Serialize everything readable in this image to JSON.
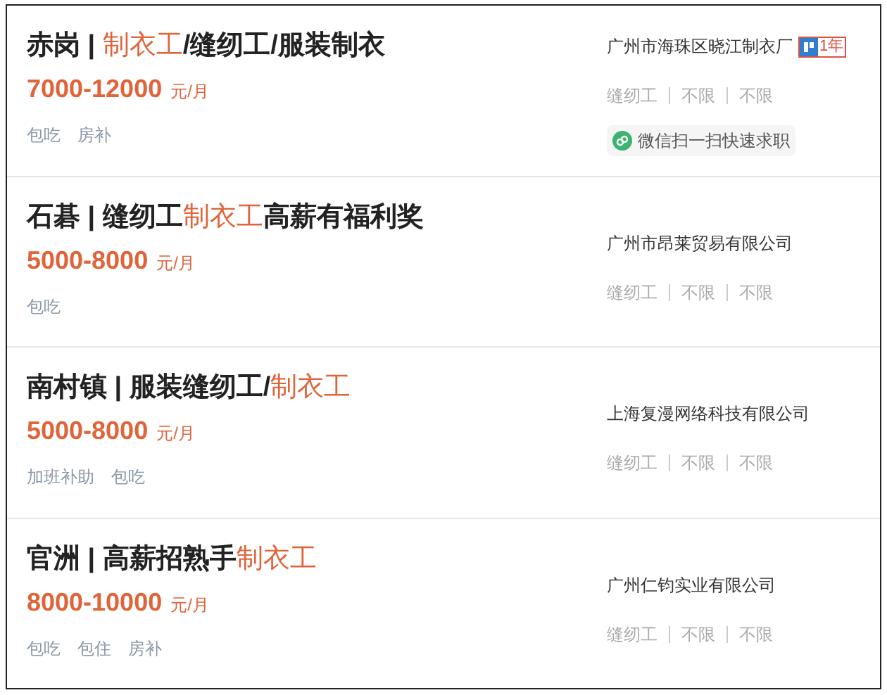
{
  "jobs": [
    {
      "title": [
        {
          "text": "赤岗 | ",
          "highlight": false
        },
        {
          "text": "制衣工",
          "highlight": true
        },
        {
          "text": "/缝纫工/服装制衣",
          "highlight": false
        }
      ],
      "salary": "7000-12000",
      "unit": "元/月",
      "benefits": [
        "包吃",
        "房补"
      ],
      "company": "广州市海珠区晓江制衣厂",
      "badge": "1年",
      "requirements": [
        "缝纫工",
        "不限",
        "不限"
      ],
      "wechat_button": "微信扫一扫快速求职"
    },
    {
      "title": [
        {
          "text": "石碁 | 缝纫工",
          "highlight": false
        },
        {
          "text": "制衣工",
          "highlight": true
        },
        {
          "text": "高薪有福利奖",
          "highlight": false
        }
      ],
      "salary": "5000-8000",
      "unit": "元/月",
      "benefits": [
        "包吃"
      ],
      "company": "广州市昂莱贸易有限公司",
      "requirements": [
        "缝纫工",
        "不限",
        "不限"
      ]
    },
    {
      "title": [
        {
          "text": "南村镇 | 服装缝纫工/",
          "highlight": false
        },
        {
          "text": "制衣工",
          "highlight": true
        }
      ],
      "salary": "5000-8000",
      "unit": "元/月",
      "benefits": [
        "加班补助",
        "包吃"
      ],
      "company": "上海复漫网络科技有限公司",
      "requirements": [
        "缝纫工",
        "不限",
        "不限"
      ]
    },
    {
      "title": [
        {
          "text": "官洲 | 高薪招熟手",
          "highlight": false
        },
        {
          "text": "制衣工",
          "highlight": true
        }
      ],
      "salary": "8000-10000",
      "unit": "元/月",
      "benefits": [
        "包吃",
        "包住",
        "房补"
      ],
      "company": "广州仁钧实业有限公司",
      "requirements": [
        "缝纫工",
        "不限",
        "不限"
      ]
    }
  ]
}
